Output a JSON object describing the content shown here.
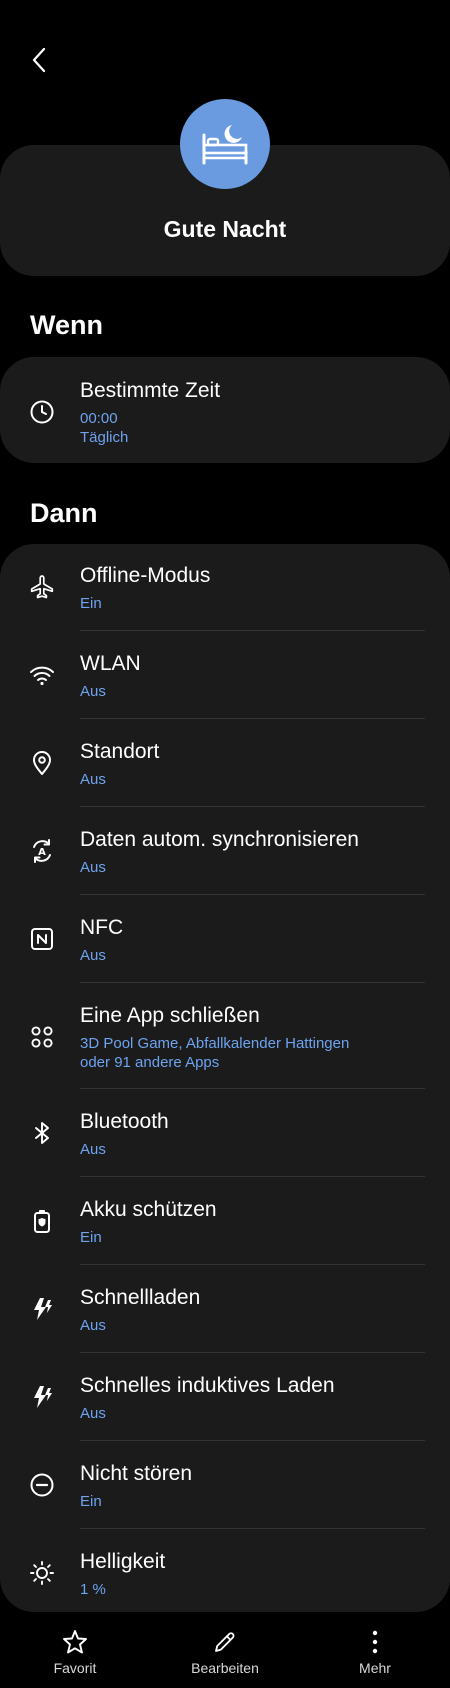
{
  "header": {
    "title": "Gute Nacht",
    "icon": "bed-moon-icon",
    "icon_color": "#6a9be0"
  },
  "when": {
    "section_label": "Wenn",
    "condition": {
      "title": "Bestimmte Zeit",
      "time": "00:00",
      "repeat": "Täglich",
      "icon": "clock-icon"
    }
  },
  "then": {
    "section_label": "Dann",
    "actions": [
      {
        "title": "Offline-Modus",
        "value": "Ein",
        "icon": "airplane-icon"
      },
      {
        "title": "WLAN",
        "value": "Aus",
        "icon": "wifi-icon"
      },
      {
        "title": "Standort",
        "value": "Aus",
        "icon": "location-pin-icon"
      },
      {
        "title": "Daten autom. synchronisieren",
        "value": "Aus",
        "icon": "auto-sync-icon"
      },
      {
        "title": "NFC",
        "value": "Aus",
        "icon": "nfc-icon"
      },
      {
        "title": "Eine App schließen",
        "value_line1": "3D Pool Game, Abfallkalender Hattingen",
        "value_line2": "oder 91 andere Apps",
        "icon": "apps-grid-icon"
      },
      {
        "title": "Bluetooth",
        "value": "Aus",
        "icon": "bluetooth-icon"
      },
      {
        "title": "Akku schützen",
        "value": "Ein",
        "icon": "battery-shield-icon"
      },
      {
        "title": "Schnellladen",
        "value": "Aus",
        "icon": "fast-charge-icon"
      },
      {
        "title": "Schnelles induktives Laden",
        "value": "Aus",
        "icon": "wireless-fast-charge-icon"
      },
      {
        "title": "Nicht stören",
        "value": "Ein",
        "icon": "do-not-disturb-icon"
      },
      {
        "title": "Helligkeit",
        "value": "1 %",
        "icon": "brightness-icon"
      }
    ]
  },
  "bottom_nav": {
    "favorite_label": "Favorit",
    "edit_label": "Bearbeiten",
    "more_label": "Mehr"
  },
  "colors": {
    "background": "#000000",
    "card": "#1b1b1b",
    "accent_text": "#6ea3f0",
    "divider": "#333333"
  }
}
